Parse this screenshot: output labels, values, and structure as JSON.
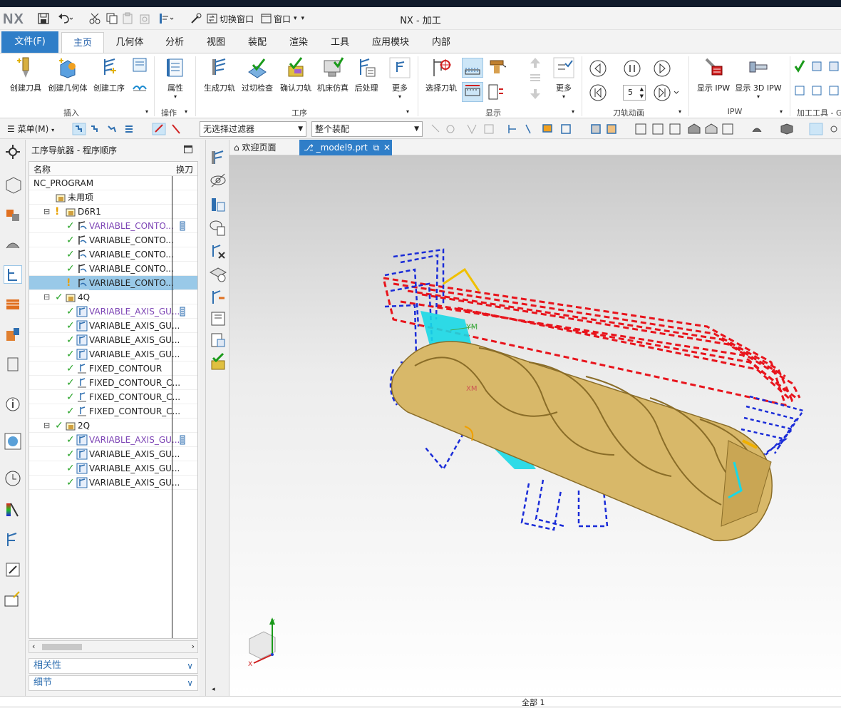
{
  "app": {
    "logo": "NX",
    "title": "NX - 加工"
  },
  "qat": {
    "switch_window": "切换窗口",
    "window": "窗口"
  },
  "menu": {
    "file": "文件(F)",
    "tabs": [
      "主页",
      "几何体",
      "分析",
      "视图",
      "装配",
      "渲染",
      "工具",
      "应用模块",
      "内部"
    ]
  },
  "ribbon": {
    "insert": {
      "group": "插入",
      "buttons": [
        "创建刀具",
        "创建几何体",
        "创建工序"
      ]
    },
    "operation": {
      "group": "操作",
      "buttons": [
        "属性"
      ]
    },
    "process": {
      "group": "工序",
      "buttons": [
        "生成刀轨",
        "过切检查",
        "确认刀轨",
        "机床仿真",
        "后处理",
        "更多"
      ]
    },
    "display": {
      "group": "显示",
      "buttons": [
        "选择刀轨",
        "更多"
      ]
    },
    "animation": {
      "group": "刀轨动画",
      "speed": "5"
    },
    "ipw": {
      "group": "IPW",
      "buttons": [
        "显示 IPW",
        "显示 3D IPW"
      ]
    },
    "tools": {
      "group": "加工工具 - GC"
    }
  },
  "toolbar2": {
    "menu": "菜单(M)",
    "filter": "无选择过滤器",
    "assembly": "整个装配"
  },
  "navigator": {
    "title": "工序导航器 - 程序顺序",
    "columns": [
      "名称",
      "换刀"
    ],
    "rows": [
      {
        "label": "NC_PROGRAM",
        "indent": 0,
        "type": "root"
      },
      {
        "label": "未用项",
        "indent": 1,
        "type": "folder"
      },
      {
        "label": "D6R1",
        "indent": 1,
        "type": "group",
        "status": "warn",
        "expand": "-"
      },
      {
        "label": "VARIABLE_CONTO...",
        "indent": 2,
        "type": "op",
        "status": "ok",
        "purple": true,
        "toolchange": true
      },
      {
        "label": "VARIABLE_CONTO...",
        "indent": 2,
        "type": "op",
        "status": "ok"
      },
      {
        "label": "VARIABLE_CONTO...",
        "indent": 2,
        "type": "op",
        "status": "ok"
      },
      {
        "label": "VARIABLE_CONTO...",
        "indent": 2,
        "type": "op",
        "status": "ok"
      },
      {
        "label": "VARIABLE_CONTO...",
        "indent": 2,
        "type": "op",
        "status": "warn",
        "selected": true
      },
      {
        "label": "4Q",
        "indent": 1,
        "type": "group",
        "status": "ok",
        "expand": "-"
      },
      {
        "label": "VARIABLE_AXIS_GU...",
        "indent": 2,
        "type": "op2",
        "status": "ok",
        "purple": true,
        "toolchange": true
      },
      {
        "label": "VARIABLE_AXIS_GU...",
        "indent": 2,
        "type": "op2",
        "status": "ok"
      },
      {
        "label": "VARIABLE_AXIS_GU...",
        "indent": 2,
        "type": "op2",
        "status": "ok"
      },
      {
        "label": "VARIABLE_AXIS_GU...",
        "indent": 2,
        "type": "op2",
        "status": "ok"
      },
      {
        "label": "FIXED_CONTOUR",
        "indent": 2,
        "type": "op3",
        "status": "ok"
      },
      {
        "label": "FIXED_CONTOUR_C...",
        "indent": 2,
        "type": "op3",
        "status": "ok"
      },
      {
        "label": "FIXED_CONTOUR_C...",
        "indent": 2,
        "type": "op3",
        "status": "ok"
      },
      {
        "label": "FIXED_CONTOUR_C...",
        "indent": 2,
        "type": "op3",
        "status": "ok"
      },
      {
        "label": "2Q",
        "indent": 1,
        "type": "group",
        "status": "ok",
        "expand": "-"
      },
      {
        "label": "VARIABLE_AXIS_GU...",
        "indent": 2,
        "type": "op2",
        "status": "ok",
        "purple": true,
        "toolchange": true
      },
      {
        "label": "VARIABLE_AXIS_GU...",
        "indent": 2,
        "type": "op2",
        "status": "ok"
      },
      {
        "label": "VARIABLE_AXIS_GU...",
        "indent": 2,
        "type": "op2",
        "status": "ok"
      },
      {
        "label": "VARIABLE_AXIS_GU...",
        "indent": 2,
        "type": "op2",
        "status": "ok"
      }
    ],
    "accordion": [
      "相关性",
      "细节"
    ]
  },
  "tabs": {
    "welcome": "欢迎页面",
    "model": "_model9.prt"
  },
  "viewport": {
    "ym_label": "YM",
    "xm_label": "XM",
    "triad": {
      "y": "Y",
      "x": "X"
    }
  },
  "status": {
    "text": "全部 1"
  },
  "colors": {
    "accent": "#2f7ec8",
    "toolpath_red": "#e8141c",
    "toolpath_blue": "#1a2cd8",
    "cutter_gold": "#d8b869",
    "cyan": "#18d8e6"
  }
}
